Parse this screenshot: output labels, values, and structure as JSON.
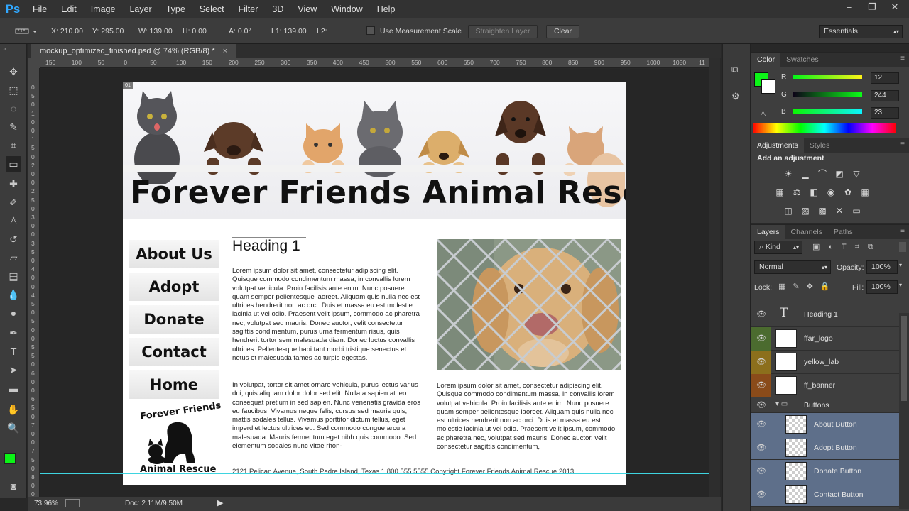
{
  "app": {
    "logo": "Ps",
    "window_controls": [
      "–",
      "❐",
      "✕"
    ]
  },
  "menu": [
    "File",
    "Edit",
    "Image",
    "Layer",
    "Type",
    "Select",
    "Filter",
    "3D",
    "View",
    "Window",
    "Help"
  ],
  "options_bar": {
    "x": "X: 210.00",
    "y": "Y: 295.00",
    "w": "W: 139.00",
    "h": "H: 0.00",
    "a": "A: 0.0°",
    "l1": "L1: 139.00",
    "l2": "L2:",
    "use_measurement_scale": "Use Measurement Scale",
    "straighten_layer": "Straighten Layer",
    "clear": "Clear",
    "workspace": "Essentials"
  },
  "document": {
    "tab_title": "mockup_optimized_finished.psd @ 74% (RGB/8) *",
    "tab_close": "×",
    "ruler_h": [
      "150",
      "100",
      "50",
      "0",
      "50",
      "100",
      "150",
      "200",
      "250",
      "300",
      "350",
      "400",
      "450",
      "500",
      "550",
      "600",
      "650",
      "700",
      "750",
      "800",
      "850",
      "900",
      "950",
      "1000",
      "1050",
      "11"
    ],
    "ruler_v": [
      "0",
      "5",
      "0",
      "1",
      "0",
      "0",
      "1",
      "5",
      "0",
      "2",
      "0",
      "0",
      "2",
      "5",
      "0",
      "3",
      "0",
      "0",
      "3",
      "5",
      "0",
      "4",
      "0",
      "0",
      "4",
      "5",
      "0",
      "5",
      "0",
      "0",
      "5",
      "5",
      "0",
      "6",
      "0",
      "0",
      "6",
      "5",
      "0",
      "7",
      "0",
      "0",
      "7",
      "5",
      "0",
      "8",
      "0",
      "0",
      "8"
    ],
    "slice_marker": "01"
  },
  "page": {
    "banner_title": "Forever Friends Animal Rescue",
    "nav": [
      "About Us",
      "Adopt",
      "Donate",
      "Contact",
      "Home"
    ],
    "heading1": "Heading 1",
    "para1": "Lorem ipsum dolor sit amet, consectetur adipiscing elit. Quisque commodo condimentum massa, in convallis lorem volutpat vehicula. Proin facilisis ante enim. Nunc posuere quam semper pellentesque laoreet. Aliquam quis nulla nec est ultrices hendrerit non ac orci. Duis et massa eu est molestie lacinia ut vel odio. Praesent velit ipsum, commodo ac pharetra nec, volutpat sed mauris. Donec auctor, velit consectetur sagittis condimentum, purus urna fermentum risus, quis hendrerit tortor sem malesuada diam. Donec luctus convallis ultrices. Pellentesque habi tant morbi tristique senectus et netus et malesuada fames ac turpis egestas.",
    "para2": "In volutpat, tortor sit amet ornare vehicula, purus lectus varius dui, quis aliquam dolor dolor sed elit. Nulla a sapien at leo consequat pretium in sed sapien. Nunc venenatis gravida eros eu faucibus. Vivamus neque felis, cursus sed mauris quis, mattis sodales tellus. Vivamus porttitor dictum tellus, eget imperdiet lectus ultrices eu. Sed commodo congue arcu a malesuada. Mauris fermentum eget nibh quis commodo. Sed elementum sodales nunc vitae rhon-",
    "para3": "Lorem ipsum dolor sit amet, consectetur adipiscing elit. Quisque commodo condimentum massa, in convallis lorem volutpat vehicula. Proin facilisis ante enim. Nunc posuere quam semper pellentesque laoreet. Aliquam quis nulla nec est ultrices hendrerit non ac orci. Duis et massa eu est molestie lacinia ut vel odio. Praesent velit ipsum, commodo ac pharetra nec, volutpat sed mauris. Donec auctor, velit consectetur sagittis condimentum,",
    "footer": "2121 Pelican Avenue, South Padre Island, Texas 1 800 555 5555   Copyright Forever Friends Animal Rescue 2013",
    "logo_text_top": "Forever Friends",
    "logo_text_bottom": "Animal Rescue"
  },
  "status_bar": {
    "zoom": "73.96%",
    "doc": "Doc: 2.11M/9.50M"
  },
  "color_panel": {
    "tabs": [
      "Color",
      "Swatches"
    ],
    "r_label": "R",
    "g_label": "G",
    "b_label": "B",
    "r": "12",
    "g": "244",
    "b": "23",
    "foreground": "#0cf417"
  },
  "adjustments_panel": {
    "tabs": [
      "Adjustments",
      "Styles"
    ],
    "title": "Add an adjustment"
  },
  "layers_panel": {
    "tabs": [
      "Layers",
      "Channels",
      "Paths"
    ],
    "filter_kind": "Kind",
    "blend_mode": "Normal",
    "opacity_label": "Opacity:",
    "opacity": "100%",
    "lock_label": "Lock:",
    "fill_label": "Fill:",
    "fill": "100%",
    "layers": [
      {
        "name": "Heading 1",
        "type": "text",
        "color": "#3e3e3e",
        "selected": false
      },
      {
        "name": "ffar_logo",
        "type": "smart",
        "color": "#4b6b2f",
        "selected": false
      },
      {
        "name": "yellow_lab",
        "type": "smart",
        "color": "#8c6f1c",
        "selected": false
      },
      {
        "name": "ff_banner",
        "type": "smart",
        "color": "#8a4b1a",
        "selected": false
      },
      {
        "name": "Buttons",
        "type": "group",
        "color": "#3e3e3e",
        "selected": false
      },
      {
        "name": "About Button",
        "type": "layer",
        "color": "#5e6f8a",
        "selected": true
      },
      {
        "name": "Adopt Button",
        "type": "layer",
        "color": "#5e6f8a",
        "selected": true
      },
      {
        "name": "Donate Button",
        "type": "layer",
        "color": "#5e6f8a",
        "selected": true
      },
      {
        "name": "Contact Button",
        "type": "layer",
        "color": "#5e6f8a",
        "selected": true
      }
    ]
  }
}
